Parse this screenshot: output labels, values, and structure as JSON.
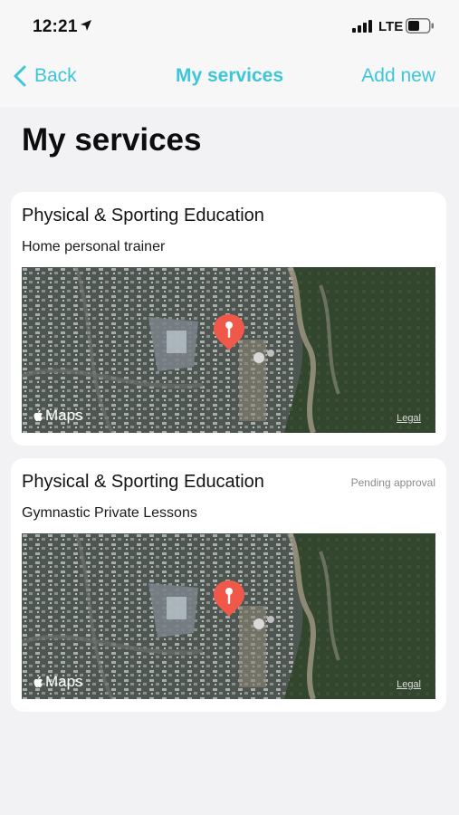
{
  "status_bar": {
    "time": "12:21",
    "network": "LTE"
  },
  "nav": {
    "back_label": "Back",
    "title": "My services",
    "add_new_label": "Add new"
  },
  "page_title": "My services",
  "services": [
    {
      "category": "Physical & Sporting Education",
      "name": "Home personal trainer",
      "status": "",
      "map_logo": "Maps",
      "map_legal": "Legal"
    },
    {
      "category": "Physical & Sporting Education",
      "name": "Gymnastic Private Lessons",
      "status": "Pending approval",
      "map_logo": "Maps",
      "map_legal": "Legal"
    }
  ],
  "colors": {
    "accent": "#3cc6d8",
    "background": "#f2f2f4",
    "pin": "#f0594a"
  },
  "icons": [
    "location-arrow-icon",
    "signal-icon",
    "battery-icon",
    "chevron-left-icon",
    "apple-icon",
    "map-pin-icon"
  ]
}
